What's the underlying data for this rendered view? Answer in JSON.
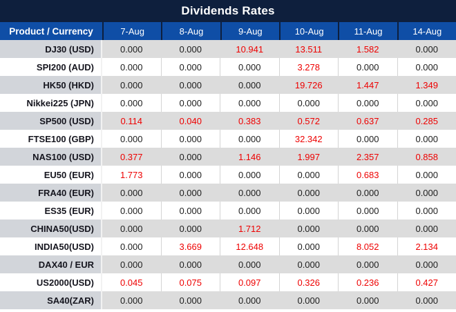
{
  "title": "Dividends Rates",
  "colors": {
    "title_bar_bg": "#0e1f3d",
    "header_row_bg": "#0f4ea6",
    "header_text": "#ffffff",
    "alt_row_value_bg": "#dcdcdc",
    "alt_row_product_bg": "#d2d5da",
    "value_text": "#1c1c1c",
    "dividend_highlight_text": "#ee0000"
  },
  "chart_data": {
    "type": "table",
    "title": "Dividends Rates",
    "columns": [
      "Product / Currency",
      "7-Aug",
      "8-Aug",
      "9-Aug",
      "10-Aug",
      "11-Aug",
      "14-Aug"
    ],
    "rows": [
      {
        "product": "DJ30 (USD)",
        "values": [
          "0.000",
          "0.000",
          "10.941",
          "13.511",
          "1.582",
          "0.000"
        ],
        "highlight": [
          false,
          false,
          true,
          true,
          true,
          false
        ]
      },
      {
        "product": "SPI200 (AUD)",
        "values": [
          "0.000",
          "0.000",
          "0.000",
          "3.278",
          "0.000",
          "0.000"
        ],
        "highlight": [
          false,
          false,
          false,
          true,
          false,
          false
        ]
      },
      {
        "product": "HK50 (HKD)",
        "values": [
          "0.000",
          "0.000",
          "0.000",
          "19.726",
          "1.447",
          "1.349"
        ],
        "highlight": [
          false,
          false,
          false,
          true,
          true,
          true
        ]
      },
      {
        "product": "Nikkei225 (JPN)",
        "values": [
          "0.000",
          "0.000",
          "0.000",
          "0.000",
          "0.000",
          "0.000"
        ],
        "highlight": [
          false,
          false,
          false,
          false,
          false,
          false
        ]
      },
      {
        "product": "SP500 (USD)",
        "values": [
          "0.114",
          "0.040",
          "0.383",
          "0.572",
          "0.637",
          "0.285"
        ],
        "highlight": [
          true,
          true,
          true,
          true,
          true,
          true
        ]
      },
      {
        "product": "FTSE100 (GBP)",
        "values": [
          "0.000",
          "0.000",
          "0.000",
          "32.342",
          "0.000",
          "0.000"
        ],
        "highlight": [
          false,
          false,
          false,
          true,
          false,
          false
        ]
      },
      {
        "product": "NAS100 (USD)",
        "values": [
          "0.377",
          "0.000",
          "1.146",
          "1.997",
          "2.357",
          "0.858"
        ],
        "highlight": [
          true,
          false,
          true,
          true,
          true,
          true
        ]
      },
      {
        "product": "EU50 (EUR)",
        "values": [
          "1.773",
          "0.000",
          "0.000",
          "0.000",
          "0.683",
          "0.000"
        ],
        "highlight": [
          true,
          false,
          false,
          false,
          true,
          false
        ]
      },
      {
        "product": "FRA40 (EUR)",
        "values": [
          "0.000",
          "0.000",
          "0.000",
          "0.000",
          "0.000",
          "0.000"
        ],
        "highlight": [
          false,
          false,
          false,
          false,
          false,
          false
        ]
      },
      {
        "product": "ES35 (EUR)",
        "values": [
          "0.000",
          "0.000",
          "0.000",
          "0.000",
          "0.000",
          "0.000"
        ],
        "highlight": [
          false,
          false,
          false,
          false,
          false,
          false
        ]
      },
      {
        "product": "CHINA50(USD)",
        "values": [
          "0.000",
          "0.000",
          "1.712",
          "0.000",
          "0.000",
          "0.000"
        ],
        "highlight": [
          false,
          false,
          true,
          false,
          false,
          false
        ]
      },
      {
        "product": "INDIA50(USD)",
        "values": [
          "0.000",
          "3.669",
          "12.648",
          "0.000",
          "8.052",
          "2.134"
        ],
        "highlight": [
          false,
          true,
          true,
          false,
          true,
          true
        ]
      },
      {
        "product": "DAX40 / EUR",
        "values": [
          "0.000",
          "0.000",
          "0.000",
          "0.000",
          "0.000",
          "0.000"
        ],
        "highlight": [
          false,
          false,
          false,
          false,
          false,
          false
        ]
      },
      {
        "product": "US2000(USD)",
        "values": [
          "0.045",
          "0.075",
          "0.097",
          "0.326",
          "0.236",
          "0.427"
        ],
        "highlight": [
          true,
          true,
          true,
          true,
          true,
          true
        ]
      },
      {
        "product": "SA40(ZAR)",
        "values": [
          "0.000",
          "0.000",
          "0.000",
          "0.000",
          "0.000",
          "0.000"
        ],
        "highlight": [
          false,
          false,
          false,
          false,
          false,
          false
        ]
      }
    ],
    "layout": {
      "first_row_shaded": true,
      "alternating_rows": true,
      "highlight_meaning": "non-zero dividend amounts shown in red"
    }
  }
}
